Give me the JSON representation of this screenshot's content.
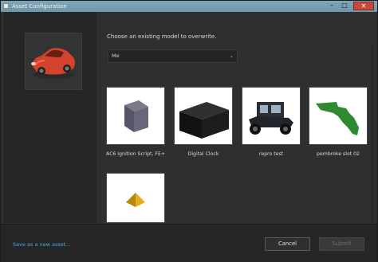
{
  "window": {
    "title": "Asset Configuration"
  },
  "prompt": "Choose an existing model to overwrite.",
  "dropdown": {
    "selected": "Me"
  },
  "models": [
    {
      "label": "AC6 Ignition Script, FE+"
    },
    {
      "label": "Digital Clock"
    },
    {
      "label": "repro test"
    },
    {
      "label": "pembroke slot 02"
    },
    {
      "label": ""
    }
  ],
  "footer": {
    "save_new": "Save as a new asset...",
    "cancel": "Cancel",
    "submit": "Submit"
  },
  "colors": {
    "accent_link": "#4aa8e8",
    "close_button": "#c94a3c"
  }
}
